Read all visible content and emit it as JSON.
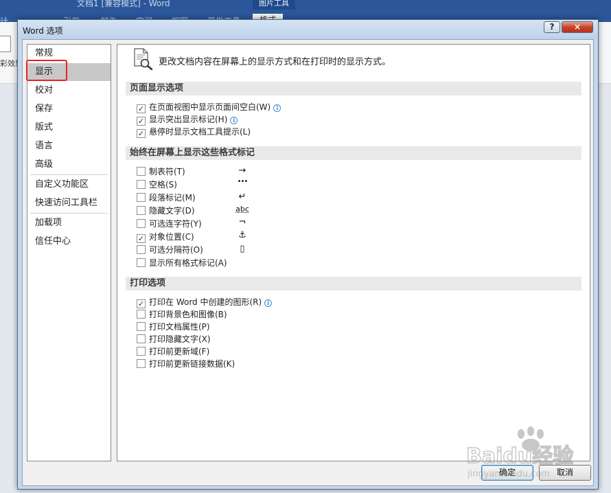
{
  "background": {
    "doc_title": "文档1 [兼容模式] - Word",
    "picture_tools": "图片工具",
    "ribbon_tabs": [
      "计",
      "引用",
      "邮件",
      "审阅",
      "视图",
      "开发工具",
      "格式"
    ],
    "left_text": "彩效果"
  },
  "dialog": {
    "title": "Word 选项",
    "help": "?",
    "close": "×"
  },
  "sidebar": {
    "items": [
      {
        "label": "常规"
      },
      {
        "label": "显示"
      },
      {
        "label": "校对"
      },
      {
        "label": "保存"
      },
      {
        "label": "版式"
      },
      {
        "label": "语言"
      },
      {
        "label": "高级"
      },
      {
        "label": "自定义功能区"
      },
      {
        "label": "快速访问工具栏"
      },
      {
        "label": "加载项"
      },
      {
        "label": "信任中心"
      }
    ]
  },
  "content": {
    "header": "更改文档内容在屏幕上的显示方式和在打印时的显示方式。",
    "sections": [
      {
        "title": "页面显示选项",
        "options": [
          {
            "label": "在页面视图中显示页面间空白(W)",
            "checked": true
          },
          {
            "label": "显示突出显示标记(H)",
            "checked": true
          },
          {
            "label": "悬停时显示文档工具提示(L)",
            "checked": true
          }
        ]
      },
      {
        "title": "始终在屏幕上显示这些格式标记",
        "options": [
          {
            "label": "制表符(T)",
            "checked": false,
            "symbol": "→"
          },
          {
            "label": "空格(S)",
            "checked": false,
            "symbol": "•••"
          },
          {
            "label": "段落标记(M)",
            "checked": false,
            "symbol": "↵"
          },
          {
            "label": "隐藏文字(D)",
            "checked": false,
            "symbol": "abc"
          },
          {
            "label": "可选连字符(Y)",
            "checked": false,
            "symbol": "¬"
          },
          {
            "label": "对象位置(C)",
            "checked": true,
            "symbol": "⚓"
          },
          {
            "label": "可选分隔符(O)",
            "checked": false,
            "symbol": "▯"
          },
          {
            "label": "显示所有格式标记(A)",
            "checked": false
          }
        ]
      },
      {
        "title": "打印选项",
        "options": [
          {
            "label": "打印在 Word 中创建的图形(R)",
            "checked": true
          },
          {
            "label": "打印背景色和图像(B)",
            "checked": false
          },
          {
            "label": "打印文档属性(P)",
            "checked": false
          },
          {
            "label": "打印隐藏文字(X)",
            "checked": false
          },
          {
            "label": "打印前更新域(F)",
            "checked": false
          },
          {
            "label": "打印前更新链接数据(K)",
            "checked": false
          }
        ]
      }
    ]
  },
  "footer": {
    "ok": "确定",
    "cancel": "取消"
  },
  "watermark": {
    "text": "Baidu经验",
    "sub": "jingyan.baidu.com"
  }
}
